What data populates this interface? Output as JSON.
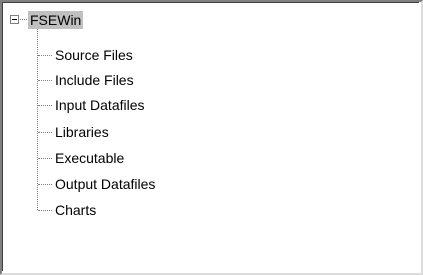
{
  "tree": {
    "root": {
      "label": "FSEWin",
      "expanded": true,
      "selected": true,
      "expander_symbol": "minus"
    },
    "children": [
      {
        "label": "Source Files"
      },
      {
        "label": "Include Files"
      },
      {
        "label": "Input Datafiles"
      },
      {
        "label": "Libraries"
      },
      {
        "label": "Executable"
      },
      {
        "label": "Output Datafiles"
      },
      {
        "label": "Charts"
      }
    ]
  },
  "colors": {
    "selection_background": "#c0c0c0",
    "tree_lines": "#808080",
    "background": "#ffffff"
  }
}
